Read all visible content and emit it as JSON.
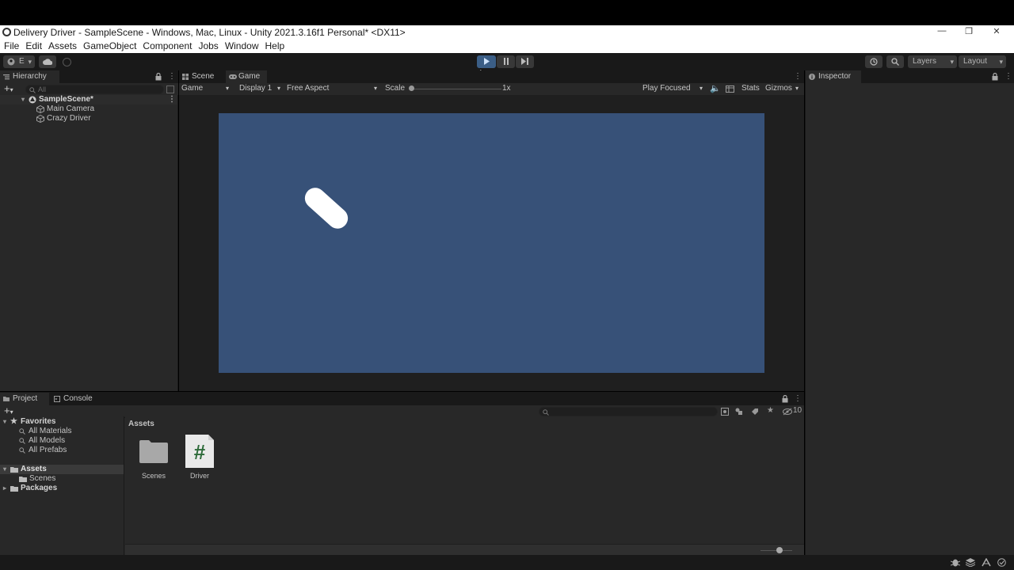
{
  "window": {
    "title": "Delivery Driver - SampleScene - Windows, Mac, Linux - Unity 2021.3.16f1 Personal* <DX11>",
    "minimize": "—",
    "maximize": "❐",
    "close": "✕"
  },
  "menu": [
    "File",
    "Edit",
    "Assets",
    "GameObject",
    "Component",
    "Jobs",
    "Window",
    "Help"
  ],
  "toolbar": {
    "account_label": "E",
    "layers_label": "Layers",
    "layout_label": "Layout"
  },
  "hierarchy": {
    "tab": "Hierarchy",
    "search_placeholder": "All",
    "scene": "SampleScene*",
    "items": [
      "Main Camera",
      "Crazy Driver"
    ]
  },
  "game_view": {
    "tabs": [
      "Scene",
      "Game"
    ],
    "mode": "Game",
    "display": "Display 1",
    "aspect": "Free Aspect",
    "scale_label": "Scale",
    "scale_value": "1x",
    "play_mode": "Play Focused",
    "stats": "Stats",
    "gizmos": "Gizmos",
    "colors": {
      "canvas": "#375178"
    }
  },
  "inspector": {
    "tab": "Inspector"
  },
  "project": {
    "tabs": [
      "Project",
      "Console"
    ],
    "hidden_count": "10",
    "favorites": {
      "label": "Favorites",
      "items": [
        "All Materials",
        "All Models",
        "All Prefabs"
      ]
    },
    "tree": {
      "assets": "Assets",
      "scenes": "Scenes",
      "packages": "Packages"
    },
    "breadcrumb": "Assets",
    "assets": [
      {
        "name": "Scenes",
        "icon": "folder-icon"
      },
      {
        "name": "Driver",
        "icon": "csharp-script-icon"
      }
    ]
  }
}
